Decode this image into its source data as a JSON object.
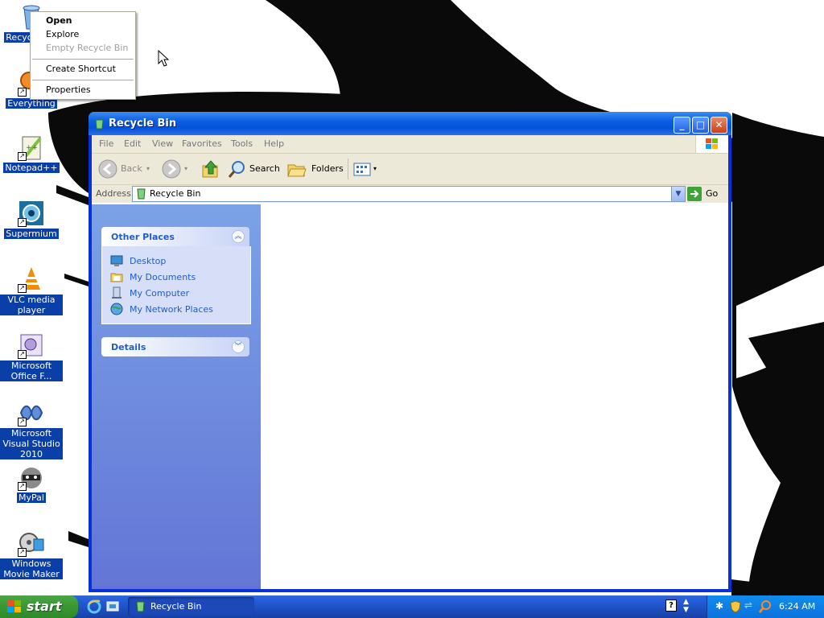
{
  "desktop": {
    "icons": [
      {
        "label": "Recycle Bin",
        "icon": "recycle-bin-icon"
      },
      {
        "label": "Everything",
        "icon": "everything-search-icon"
      },
      {
        "label": "Notepad++",
        "icon": "notepad-plus-plus-icon"
      },
      {
        "label": "Supermium",
        "icon": "supermium-browser-icon"
      },
      {
        "label": "VLC media player",
        "icon": "vlc-cone-icon"
      },
      {
        "label": "Microsoft Office F...",
        "icon": "office-picture-icon"
      },
      {
        "label": "Microsoft Visual Studio 2010",
        "icon": "visual-studio-icon"
      },
      {
        "label": "MyPal",
        "icon": "mypal-raccoon-icon"
      },
      {
        "label": "Windows Movie Maker",
        "icon": "movie-maker-icon"
      }
    ]
  },
  "context_menu": {
    "items": [
      "Open",
      "Explore",
      "Empty Recycle Bin",
      "Create Shortcut",
      "Properties"
    ]
  },
  "window": {
    "title": "Recycle Bin",
    "menu": [
      "File",
      "Edit",
      "View",
      "Favorites",
      "Tools",
      "Help"
    ],
    "toolbar": {
      "back": "Back",
      "search": "Search",
      "folders": "Folders"
    },
    "address": {
      "label": "Address",
      "value": "Recycle Bin",
      "go": "Go"
    },
    "task_pane": {
      "other_places": {
        "title": "Other Places",
        "items": [
          "Desktop",
          "My Documents",
          "My Computer",
          "My Network Places"
        ]
      },
      "details": {
        "title": "Details"
      }
    }
  },
  "taskbar": {
    "start_label": "start",
    "task_title": "Recycle Bin",
    "clock": "6:24 AM"
  },
  "colors": {
    "title_bar": "#0453d9",
    "task_pane": "#6d8be0",
    "taskbar": "#245edb",
    "start_button": "#3c9a35",
    "selection": "#0b3fa8"
  }
}
